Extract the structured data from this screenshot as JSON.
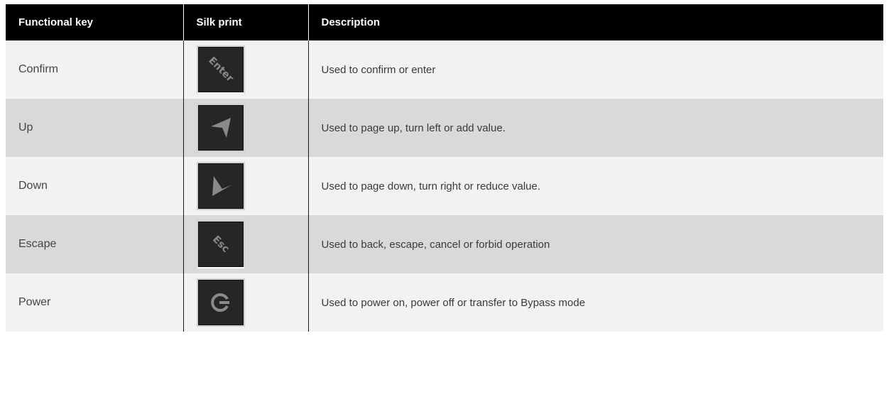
{
  "table": {
    "headers": [
      "Functional key",
      "Silk print",
      "Description"
    ],
    "rows": [
      {
        "key": "Confirm",
        "silk_icon": "enter-key-icon",
        "silk_text": "Enter",
        "description": "Used to confirm or enter"
      },
      {
        "key": "Up",
        "silk_icon": "up-arrow-key-icon",
        "silk_text": "",
        "description": "Used to page up, turn left or add value."
      },
      {
        "key": "Down",
        "silk_icon": "down-arrow-key-icon",
        "silk_text": "",
        "description": "Used to page down, turn right or reduce value."
      },
      {
        "key": "Escape",
        "silk_icon": "esc-key-icon",
        "silk_text": "Esc",
        "description": "Used to back, escape, cancel or forbid operation"
      },
      {
        "key": "Power",
        "silk_icon": "power-key-icon",
        "silk_text": "",
        "description": "Used to power on, power off or transfer to Bypass mode"
      }
    ]
  },
  "colors": {
    "header_bg": "#000000",
    "header_text": "#ffffff",
    "row_light": "#f2f2f2",
    "row_dark": "#d9d9d9",
    "keycap": "#262626",
    "glyph": "#8a8a8a"
  }
}
